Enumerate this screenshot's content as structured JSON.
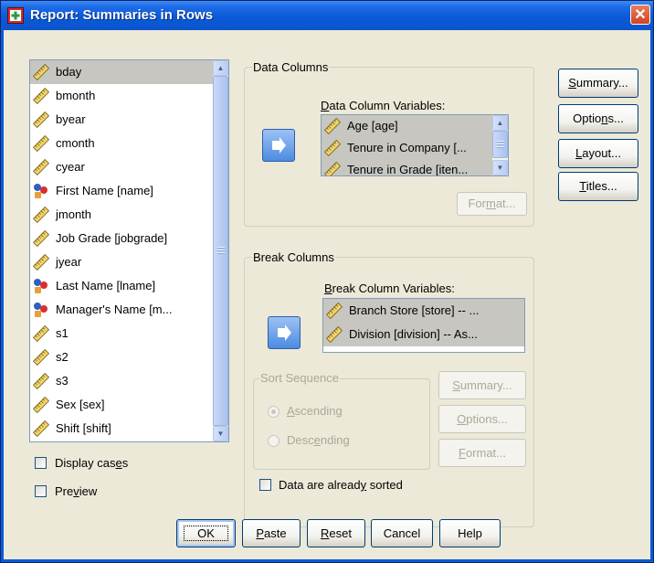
{
  "window": {
    "title": "Report: Summaries in Rows",
    "close_glyph": "✕"
  },
  "source_list": {
    "items": [
      {
        "label": "bday",
        "icon": "ruler-icon",
        "selected": true
      },
      {
        "label": "bmonth",
        "icon": "ruler-icon"
      },
      {
        "label": "byear",
        "icon": "ruler-icon"
      },
      {
        "label": "cmonth",
        "icon": "ruler-icon"
      },
      {
        "label": "cyear",
        "icon": "ruler-icon"
      },
      {
        "label": "First Name [name]",
        "icon": "nominal-icon"
      },
      {
        "label": "jmonth",
        "icon": "ruler-icon"
      },
      {
        "label": "Job Grade [jobgrade]",
        "icon": "ruler-icon"
      },
      {
        "label": "jyear",
        "icon": "ruler-icon"
      },
      {
        "label": "Last Name [lname]",
        "icon": "nominal-icon"
      },
      {
        "label": "Manager's Name [m...",
        "icon": "nominal-icon"
      },
      {
        "label": "s1",
        "icon": "ruler-icon"
      },
      {
        "label": "s2",
        "icon": "ruler-icon"
      },
      {
        "label": "s3",
        "icon": "ruler-icon"
      },
      {
        "label": "Sex [sex]",
        "icon": "ruler-icon"
      },
      {
        "label": "Shift [shift]",
        "icon": "ruler-icon"
      }
    ]
  },
  "data_columns": {
    "group_title": "Data Columns",
    "list_label": "Data Column Variables:",
    "items": [
      {
        "label": "Age [age]",
        "selected": true
      },
      {
        "label": "Tenure in Company [...",
        "selected": true
      },
      {
        "label": "Tenure in Grade [iten...",
        "selected": true
      }
    ],
    "format_button": "Format..."
  },
  "break_columns": {
    "group_title": "Break Columns",
    "list_label": "Break Column Variables:",
    "items": [
      {
        "label": "Branch Store [store] -- ...",
        "selected": true
      },
      {
        "label": "Division [division] -- As...",
        "selected": true
      }
    ],
    "sort_sequence_title": "Sort Sequence",
    "sort_options": [
      "Ascending",
      "Descending"
    ],
    "sort_selected": "Ascending",
    "summary_button": "Summary...",
    "options_button": "Options...",
    "format_button": "Format...",
    "already_sorted_label": "Data are already sorted"
  },
  "right_buttons": {
    "summary": "Summary...",
    "options": "Options...",
    "layout": "Layout...",
    "titles": "Titles..."
  },
  "left_checks": {
    "display_cases": "Display cases",
    "preview": "Preview"
  },
  "bottom_buttons": {
    "ok": "OK",
    "paste": "Paste",
    "reset": "Reset",
    "cancel": "Cancel",
    "help": "Help"
  },
  "colors": {
    "title_bar": "#0b5ad6",
    "dialog_bg": "#ece9d8",
    "selection": "#c8c6c0",
    "arrow_button": "#4d8be0"
  }
}
